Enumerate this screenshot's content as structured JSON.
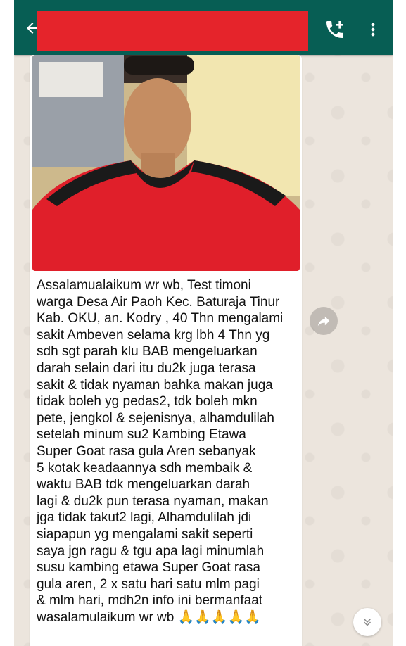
{
  "header": {
    "contact_name": "",
    "back_icon": "arrow-back-icon",
    "call_icon": "add-call-icon",
    "menu_icon": "more-vert-icon",
    "header_color": "#075e54",
    "redaction_color": "#e5242b"
  },
  "message": {
    "image_description_icon": "photo-of-man-in-red-shirt",
    "caption": "Assalamualaikum wr wb, Test timoni\nwarga Desa Air Paoh Kec. Baturaja Tinur\nKab. OKU,  an. Kodry , 40 Thn mengalami\nsakit Ambeven selama krg lbh 4 Thn yg\nsdh sgt parah klu BAB mengeluarkan\ndarah selain dari itu du2k juga terasa\nsakit & tidak nyaman bahka makan juga\ntidak boleh yg pedas2, tdk boleh mkn\npete, jengkol & sejenisnya,   alhamdulilah\nsetelah minum su2 Kambing Etawa\nSuper Goat rasa gula Aren sebanyak\n5  kotak keadaannya sdh membaik &\nwaktu BAB tdk mengeluarkan darah\nlagi & du2k pun terasa nyaman, makan\njga tidak takut2 lagi, Alhamdulilah jdi\nsiapapun yg mengalami sakit seperti\nsaya jgn ragu & tgu apa lagi minumlah\nsusu kambing etawa Super Goat rasa\ngula aren, 2 x  satu hari satu mlm pagi\n& mlm hari, mdh2n info ini bermanfaat\nwasalamulaikum wr wb 🙏🙏🙏🙏🙏"
  },
  "actions": {
    "forward_icon": "forward-share-icon",
    "scroll_down_icon": "double-chevron-down-icon"
  }
}
